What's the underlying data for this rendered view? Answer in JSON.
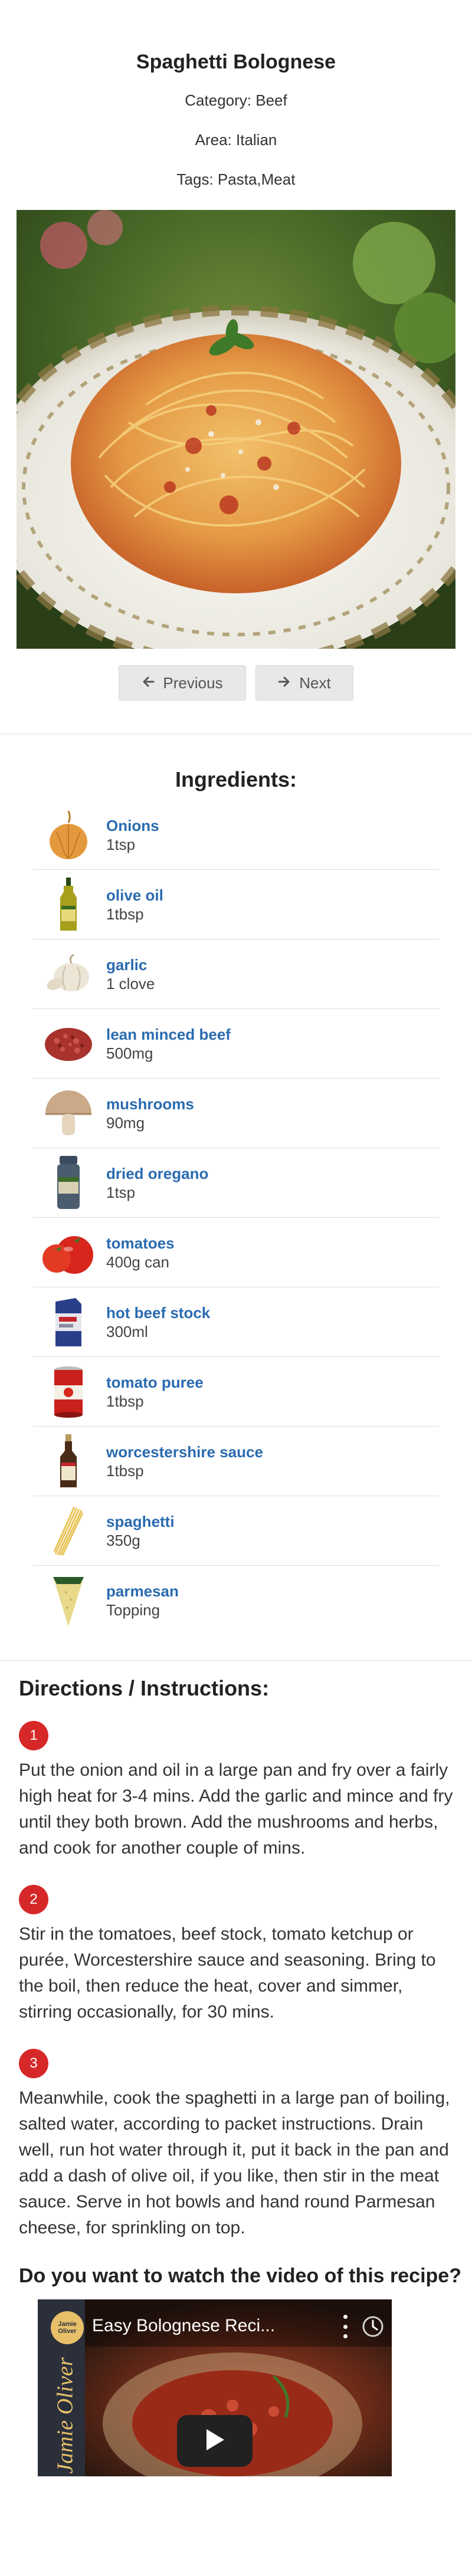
{
  "recipe": {
    "title": "Spaghetti Bolognese",
    "category": "Category: Beef",
    "area": "Area: Italian",
    "tags": "Tags: Pasta,Meat"
  },
  "nav": {
    "previous_label": "Previous",
    "next_label": "Next"
  },
  "ingredients": {
    "heading": "Ingredients:",
    "items": [
      {
        "name": "Onions",
        "measure": "1tsp",
        "icon": "onion-icon"
      },
      {
        "name": "olive oil",
        "measure": "1tbsp",
        "icon": "olive-oil-icon"
      },
      {
        "name": "garlic",
        "measure": "1 clove",
        "icon": "garlic-icon"
      },
      {
        "name": "lean minced beef",
        "measure": "500mg",
        "icon": "minced-beef-icon"
      },
      {
        "name": "mushrooms",
        "measure": "90mg",
        "icon": "mushroom-icon"
      },
      {
        "name": "dried oregano",
        "measure": "1tsp",
        "icon": "oregano-jar-icon"
      },
      {
        "name": "tomatoes",
        "measure": "400g can",
        "icon": "tomato-icon"
      },
      {
        "name": "hot beef stock",
        "measure": "300ml",
        "icon": "beef-stock-icon"
      },
      {
        "name": "tomato puree",
        "measure": "1tbsp",
        "icon": "tomato-puree-can-icon"
      },
      {
        "name": "worcestershire sauce",
        "measure": "1tbsp",
        "icon": "sauce-bottle-icon"
      },
      {
        "name": "spaghetti",
        "measure": "350g",
        "icon": "spaghetti-icon"
      },
      {
        "name": "parmesan",
        "measure": "Topping",
        "icon": "parmesan-icon"
      }
    ]
  },
  "directions": {
    "heading": "Directions / Instructions:",
    "steps": [
      {
        "number": "1",
        "text": "Put the onion and oil in a large pan and fry over a fairly high heat for 3-4 mins. Add the garlic and mince and fry until they both brown. Add the mushrooms and herbs, and cook for another couple of mins."
      },
      {
        "number": "2",
        "text": "Stir in the tomatoes, beef stock, tomato ketchup or purée, Worcestershire sauce and seasoning. Bring to the boil, then reduce the heat, cover and simmer, stirring occasionally, for 30 mins."
      },
      {
        "number": "3",
        "text": "Meanwhile, cook the spaghetti in a large pan of boiling, salted water, according to packet instructions. Drain well, run hot water through it, put it back in the pan and add a dash of olive oil, if you like, then stir in the meat sauce. Serve in hot bowls and hand round Parmesan cheese, for sprinkling on top."
      }
    ]
  },
  "video": {
    "question": "Do you want to watch the video of this recipe?",
    "title": "Easy Bolognese Reci...",
    "channel_badge": "Jamie Oliver",
    "channel_badge_short": "Jamie Oliver"
  }
}
